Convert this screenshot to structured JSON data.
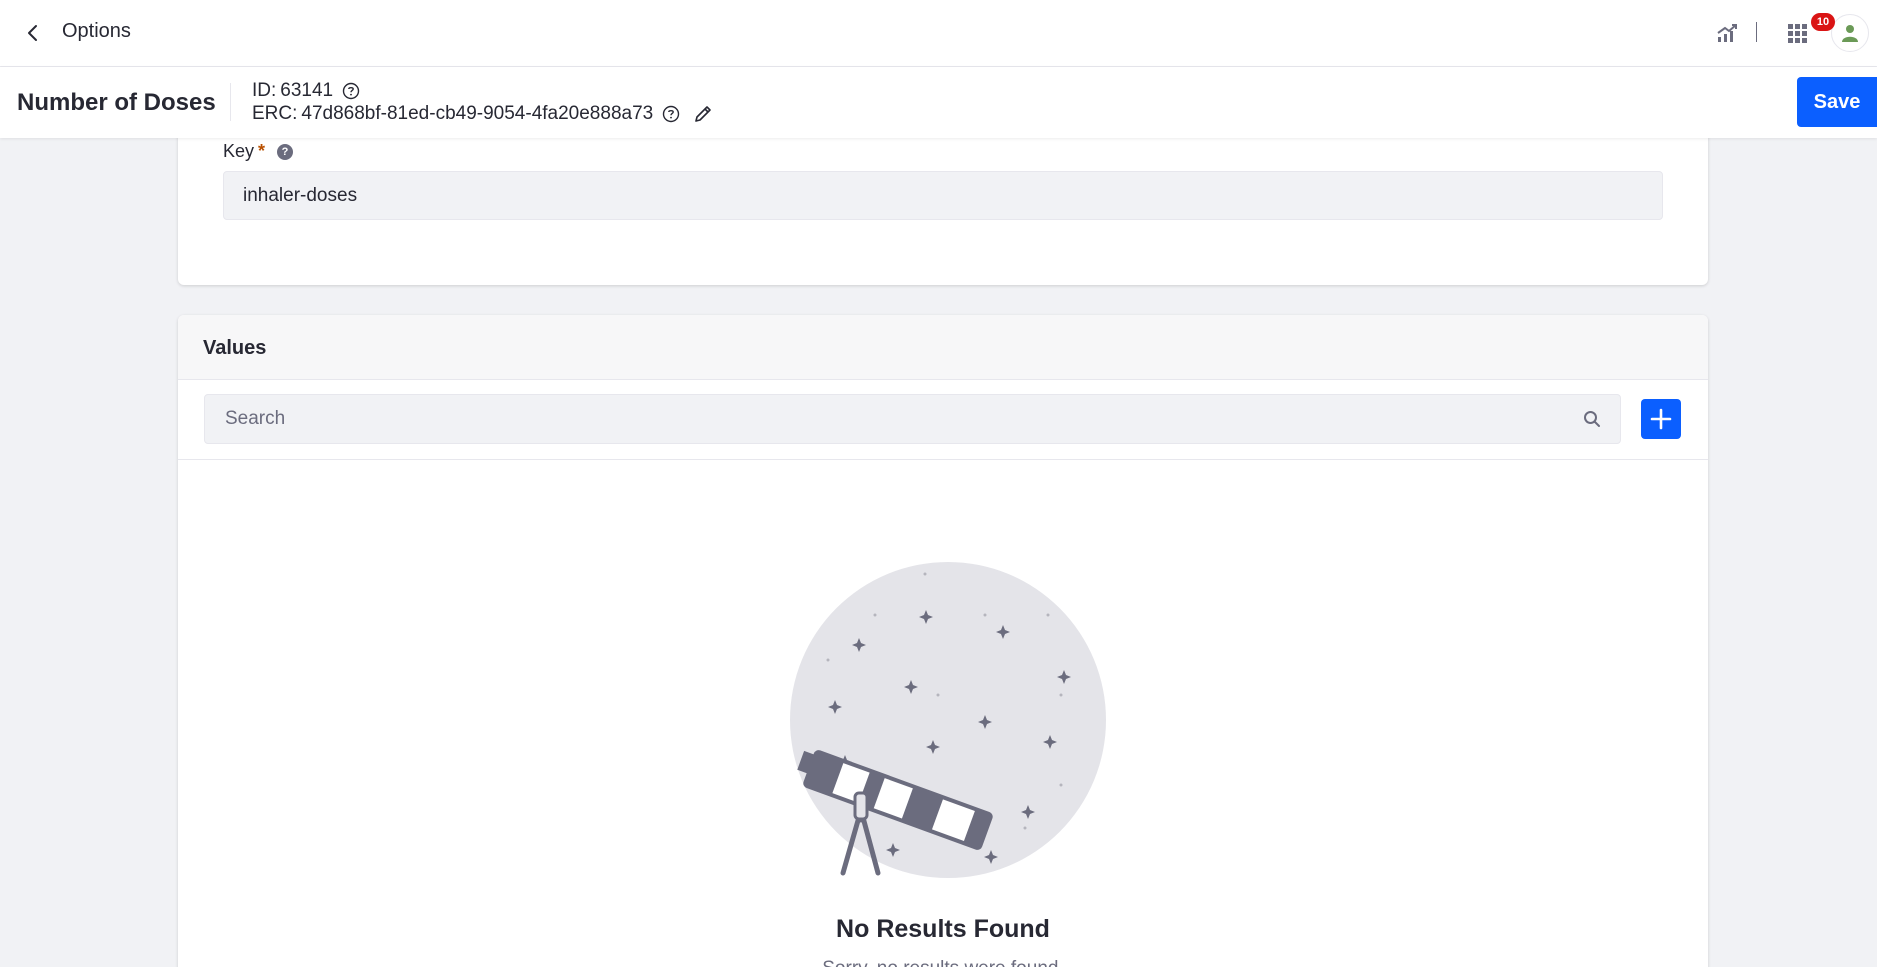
{
  "topbar": {
    "title": "Options",
    "notification_count": "10",
    "icons": [
      "back-chevron-icon",
      "analytics-icon",
      "apps-grid-icon",
      "user-avatar-icon"
    ]
  },
  "header": {
    "entity_title": "Number of Doses",
    "id_label": "ID:",
    "id_value": "63141",
    "erc_label": "ERC:",
    "erc_value": "47d868bf-81ed-cb49-9054-4fa20e888a73",
    "save_label": "Save"
  },
  "key_field": {
    "label": "Key",
    "required_mark": "*",
    "help_glyph": "?",
    "value": "inhaler-doses"
  },
  "values_section": {
    "title": "Values",
    "search_placeholder": "Search",
    "empty_title": "No Results Found",
    "empty_subtitle": "Sorry, no results were found."
  },
  "colors": {
    "primary": "#0b5fff",
    "badge": "#da1414",
    "required": "#b95000",
    "background": "#f1f2f5"
  }
}
